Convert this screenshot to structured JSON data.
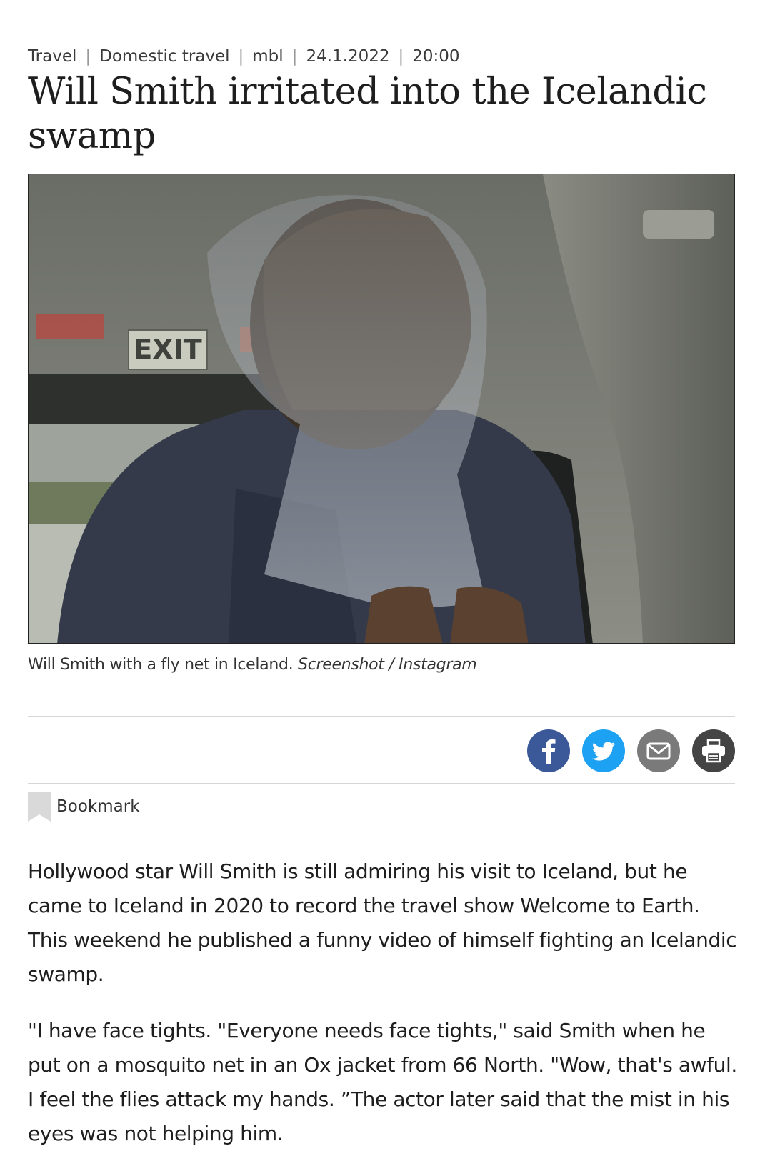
{
  "breadcrumb": {
    "items": [
      "Travel",
      "Domestic travel",
      "mbl",
      "24.1.2022",
      "20:00"
    ],
    "separator": "|"
  },
  "article": {
    "title": "Will Smith irritated into the Icelandic swamp",
    "image": {
      "exit_sign": "EXIT"
    },
    "caption": {
      "text": "Will Smith with a fly net in Iceland.",
      "credit": "Screenshot / Instagram"
    },
    "paragraphs": [
      "Hollywood star Will Smith is still admiring his visit to Iceland, but he came to Iceland in 2020 to record the travel show Welcome to Earth. This weekend he published a funny video of himself fighting an Icelandic swamp.",
      "\"I have face tights. \"Everyone needs face tights,\" said Smith when he put on a mosquito net in an Ox jacket from 66 North. \"Wow, that's awful. I feel the flies attack my hands. ”The actor later said that the mist in his eyes was not helping him."
    ]
  },
  "share": {
    "buttons": [
      {
        "icon": "facebook-icon",
        "color": "#3b5998"
      },
      {
        "icon": "twitter-icon",
        "color": "#1da1f2"
      },
      {
        "icon": "email-icon",
        "color": "#7a7a7a"
      },
      {
        "icon": "print-icon",
        "color": "#444444"
      }
    ]
  },
  "bookmark": {
    "label": "Bookmark"
  }
}
